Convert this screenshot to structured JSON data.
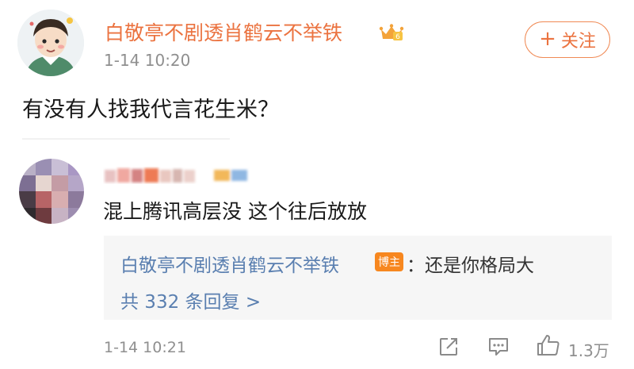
{
  "post": {
    "author": "白敬亭不剧透肖鹤云不举铁",
    "author_badge_icon": "crown-icon",
    "time": "1-14 10:20",
    "follow_button": "关注",
    "follow_prefix": "+",
    "text": "有没有人找我代言花生米？"
  },
  "comment": {
    "text": "混上腾讯高层没 这个往后放放",
    "time": "1-14 10:21",
    "reply": {
      "author": "白敬亭不剧透肖鹤云不举铁",
      "author_badge": "博主",
      "separator_and_text": "：还是你格局大",
      "more_label": "共 332 条回复 >"
    },
    "actions": {
      "share_icon": "share-icon",
      "reply_icon": "comment-icon",
      "like_icon": "thumbs-up-icon",
      "like_count": "1.3万"
    }
  },
  "colors": {
    "author_orange": "#eb7340",
    "reply_blue": "#5a7fb0",
    "badge_orange": "#f7871f",
    "meta_gray": "#8f8f8f"
  }
}
